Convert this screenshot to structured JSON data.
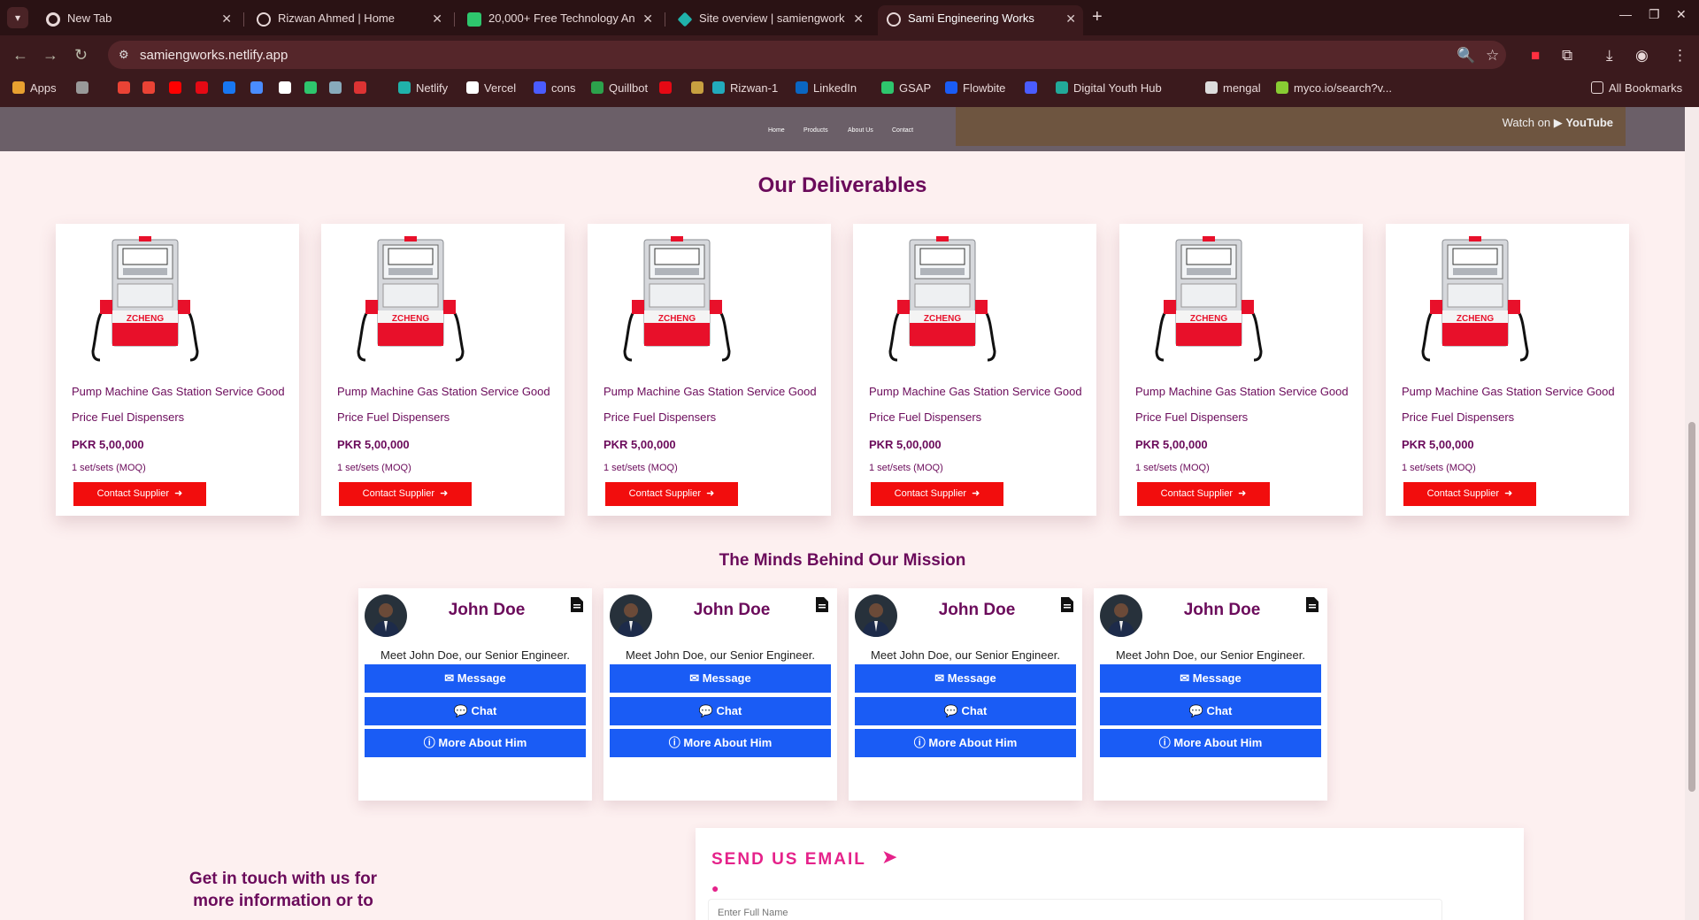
{
  "browser": {
    "tabs": [
      {
        "label": "New Tab",
        "icon": "chrome-icon",
        "color": "#e8d8d8"
      },
      {
        "label": "Rizwan Ahmed | Home",
        "icon": "globe-icon",
        "color": "#e8d8d8"
      },
      {
        "label": "20,000+ Free Technology An",
        "icon": "pixabay-icon",
        "color": "#2ec66d"
      },
      {
        "label": "Site overview | samiengwork",
        "icon": "netlify-icon",
        "color": "#20b2aa"
      },
      {
        "label": "Sami Engineering Works",
        "icon": "globe-icon",
        "color": "#e8d8d8"
      }
    ],
    "url": "samiengworks.netlify.app",
    "bookmarks": [
      {
        "label": "Apps"
      },
      {
        "label": ""
      },
      {
        "label": ""
      },
      {
        "label": ""
      },
      {
        "label": ""
      },
      {
        "label": ""
      },
      {
        "label": ""
      },
      {
        "label": ""
      },
      {
        "label": ""
      },
      {
        "label": ""
      },
      {
        "label": ""
      },
      {
        "label": ""
      },
      {
        "label": "Netlify"
      },
      {
        "label": "Vercel"
      },
      {
        "label": "cons"
      },
      {
        "label": "Quillbot"
      },
      {
        "label": ""
      },
      {
        "label": ""
      },
      {
        "label": "Rizwan-1"
      },
      {
        "label": "LinkedIn"
      },
      {
        "label": "GSAP"
      },
      {
        "label": "Flowbite"
      },
      {
        "label": ""
      },
      {
        "label": "Digital Youth Hub"
      },
      {
        "label": "mengal"
      },
      {
        "label": "myco.io/search?v..."
      }
    ],
    "all_bookmarks": "All Bookmarks"
  },
  "hero": {
    "nav": [
      "Home",
      "Products",
      "About Us",
      "Contact"
    ],
    "watch_on": "Watch on",
    "youtube": "YouTube"
  },
  "deliverables": {
    "title": "Our Deliverables",
    "products": [
      {
        "title": "Pump Machine Gas Station Service Good Price Fuel Dispensers",
        "price": "PKR 5,00,000",
        "moq": "1 set/sets (MOQ)",
        "button": "Contact Supplier",
        "brand": "ZCHENG"
      },
      {
        "title": "Pump Machine Gas Station Service Good Price Fuel Dispensers",
        "price": "PKR 5,00,000",
        "moq": "1 set/sets (MOQ)",
        "button": "Contact Supplier",
        "brand": "ZCHENG"
      },
      {
        "title": "Pump Machine Gas Station Service Good Price Fuel Dispensers",
        "price": "PKR 5,00,000",
        "moq": "1 set/sets (MOQ)",
        "button": "Contact Supplier",
        "brand": "ZCHENG"
      },
      {
        "title": "Pump Machine Gas Station Service Good Price Fuel Dispensers",
        "price": "PKR 5,00,000",
        "moq": "1 set/sets (MOQ)",
        "button": "Contact Supplier",
        "brand": "ZCHENG"
      },
      {
        "title": "Pump Machine Gas Station Service Good Price Fuel Dispensers",
        "price": "PKR 5,00,000",
        "moq": "1 set/sets (MOQ)",
        "button": "Contact Supplier",
        "brand": "ZCHENG"
      },
      {
        "title": "Pump Machine Gas Station Service Good Price Fuel Dispensers",
        "price": "PKR 5,00,000",
        "moq": "1 set/sets (MOQ)",
        "button": "Contact Supplier",
        "brand": "ZCHENG"
      }
    ]
  },
  "team": {
    "title": "The Minds Behind Our Mission",
    "members": [
      {
        "name": "John Doe",
        "desc": "Meet John Doe, our Senior Engineer.",
        "message": "Message",
        "chat": "Chat",
        "more": "More About Him"
      },
      {
        "name": "John Doe",
        "desc": "Meet John Doe, our Senior Engineer.",
        "message": "Message",
        "chat": "Chat",
        "more": "More About Him"
      },
      {
        "name": "John Doe",
        "desc": "Meet John Doe, our Senior Engineer.",
        "message": "Message",
        "chat": "Chat",
        "more": "More About Him"
      },
      {
        "name": "John Doe",
        "desc": "Meet John Doe, our Senior Engineer.",
        "message": "Message",
        "chat": "Chat",
        "more": "More About Him"
      }
    ]
  },
  "contact": {
    "heading": "Get in touch with us for more information or to",
    "email_title": "SEND US EMAIL",
    "fullname_placeholder": "Enter Full Name"
  },
  "colors": {
    "accent": "#6b0b5b",
    "button_red": "#f20d0d",
    "button_blue": "#1a5cf5",
    "pink": "#e5228a"
  }
}
